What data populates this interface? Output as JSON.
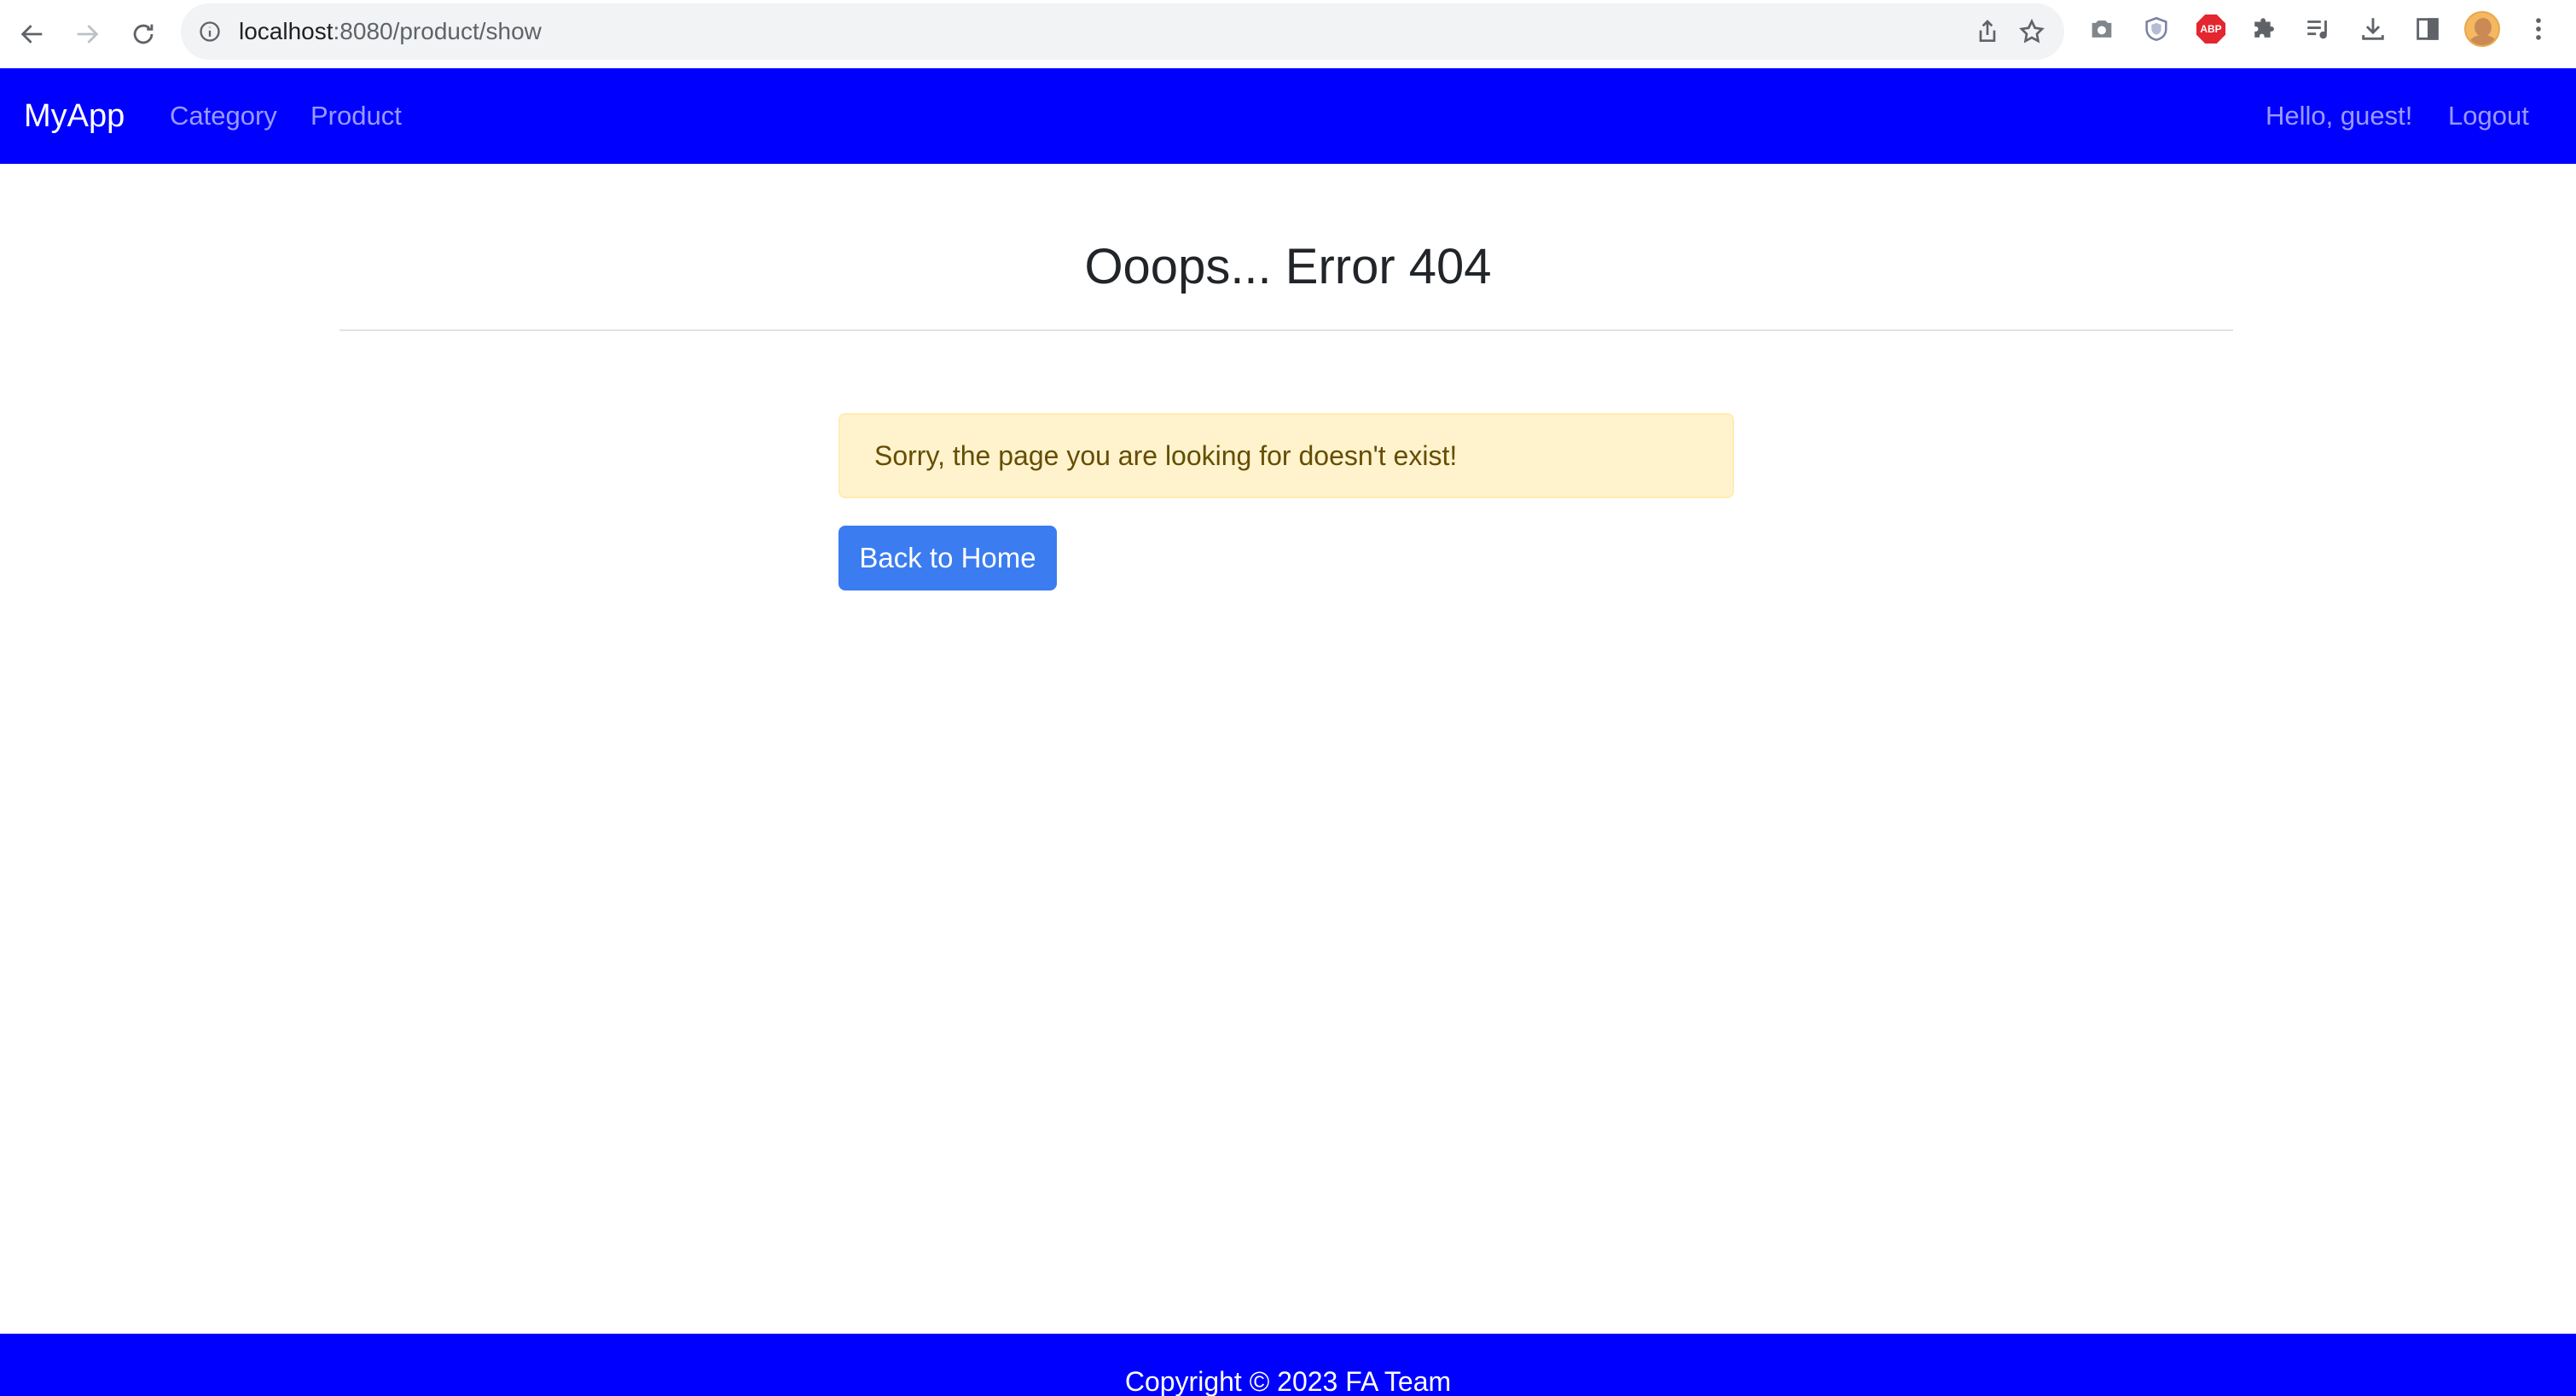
{
  "browser": {
    "url_host": "localhost",
    "url_rest": ":8080/product/show"
  },
  "navbar": {
    "brand": "MyApp",
    "links": [
      "Category",
      "Product"
    ],
    "greeting": "Hello, guest!",
    "logout": "Logout",
    "background": "#0000ff"
  },
  "main": {
    "title": "Ooops... Error 404",
    "alert_message": "Sorry, the page you are looking for doesn't exist!",
    "home_button": "Back to Home"
  },
  "footer": {
    "text": "Copyright © 2023 FA Team"
  },
  "colors": {
    "navbar": "#0000ff",
    "button": "#3b7cf0",
    "alert_bg": "#fff3cd",
    "alert_text": "#664d03"
  },
  "icons": [
    "back-arrow-icon",
    "forward-arrow-icon",
    "reload-icon",
    "info-icon",
    "share-icon",
    "star-icon",
    "camera-icon",
    "shield-icon",
    "abp-icon",
    "puzzle-icon",
    "media-queue-icon",
    "download-icon",
    "side-panel-icon",
    "avatar",
    "kebab-menu-icon"
  ]
}
